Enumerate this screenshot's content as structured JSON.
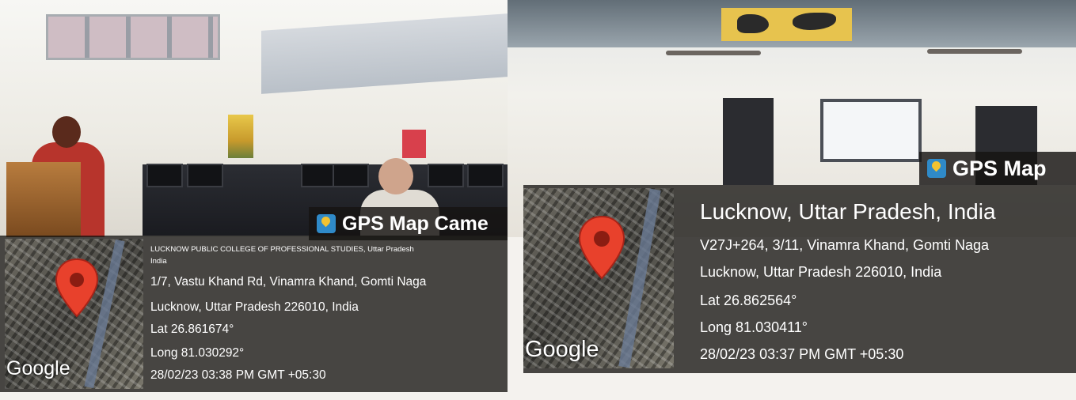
{
  "left_photo": {
    "tag": "GPS Map Came",
    "place_title": "LUCKNOW PUBLIC COLLEGE OF PROFESSIONAL STUDIES, Uttar Pradesh",
    "country_line": "India",
    "address_line1": "1/7, Vastu Khand Rd, Vinamra Khand, Gomti Naga",
    "address_line2": "Lucknow, Uttar Pradesh 226010, India",
    "lat": "Lat 26.861674°",
    "long": "Long 81.030292°",
    "timestamp": "28/02/23 03:38 PM GMT +05:30",
    "map_brand": "Google"
  },
  "right_photo": {
    "tag": "GPS Map",
    "place_title": "Lucknow, Uttar Pradesh, India",
    "address_line1": "V27J+264, 3/11, Vinamra Khand, Gomti Naga",
    "address_line2": "Lucknow, Uttar Pradesh 226010, India",
    "lat": "Lat 26.862564°",
    "long": "Long 81.030411°",
    "timestamp": "28/02/23 03:37 PM GMT +05:30",
    "map_brand": "Google"
  },
  "colors": {
    "overlay": "#161412",
    "pin": "#e8412c",
    "speaker_top": "#b7342c"
  }
}
